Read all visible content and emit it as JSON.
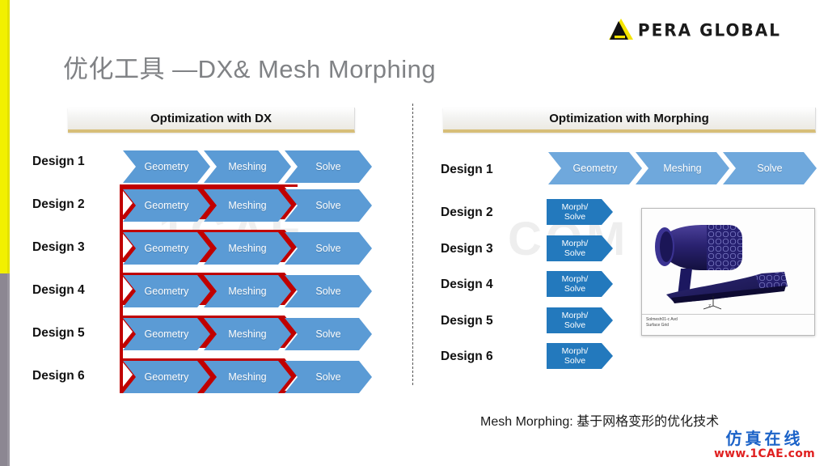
{
  "slide": {
    "title": "优化工具 —DX& Mesh Morphing",
    "caption": "Mesh Morphing: 基于网格变形的优化技术"
  },
  "logo": {
    "wordmark": "PERA GLOBAL",
    "mark_icon": "pera-triangle-icon",
    "yellow": "#F4E400",
    "black": "#111111"
  },
  "edge_bars": {
    "yellow": "#F2F000",
    "gray": "#8C8792"
  },
  "left_panel": {
    "header": "Optimization with DX",
    "stage_labels": [
      "Geometry",
      "Meshing",
      "Solve"
    ],
    "design_labels": [
      "Design 1",
      "Design 2",
      "Design 3",
      "Design 4",
      "Design 5",
      "Design 6"
    ],
    "rows": [
      {
        "label": "Design 1",
        "stages": [
          "Geometry",
          "Meshing",
          "Solve"
        ],
        "highlighted": false
      },
      {
        "label": "Design 2",
        "stages": [
          "Geometry",
          "Meshing",
          "Solve"
        ],
        "highlighted": true
      },
      {
        "label": "Design 3",
        "stages": [
          "Geometry",
          "Meshing",
          "Solve"
        ],
        "highlighted": true
      },
      {
        "label": "Design 4",
        "stages": [
          "Geometry",
          "Meshing",
          "Solve"
        ],
        "highlighted": true
      },
      {
        "label": "Design 5",
        "stages": [
          "Geometry",
          "Meshing",
          "Solve"
        ],
        "highlighted": true
      },
      {
        "label": "Design 6",
        "stages": [
          "Geometry",
          "Meshing",
          "Solve"
        ],
        "highlighted": true
      }
    ],
    "highlight_color": "#C00000",
    "chevron_color": "#5B9BD5"
  },
  "right_panel": {
    "header": "Optimization with Morphing",
    "rows": [
      {
        "label": "Design 1",
        "type": "full",
        "stages": [
          "Geometry",
          "Meshing",
          "Solve"
        ]
      },
      {
        "label": "Design 2",
        "type": "morph",
        "line1": "Morph/",
        "line2": "Solve"
      },
      {
        "label": "Design 3",
        "type": "morph",
        "line1": "Morph/",
        "line2": "Solve"
      },
      {
        "label": "Design 4",
        "type": "morph",
        "line1": "Morph/",
        "line2": "Solve"
      },
      {
        "label": "Design 5",
        "type": "morph",
        "line1": "Morph/",
        "line2": "Solve"
      },
      {
        "label": "Design 6",
        "type": "morph",
        "line1": "Morph/",
        "line2": "Solve"
      }
    ],
    "morph_color": "#2379BD",
    "chevron_color": "#5B9BD5"
  },
  "thumbnail": {
    "name": "cfd-surface-mesh-image",
    "legend_line1": "Solmesh01-c  Avd",
    "legend_line2": "Surface Grid",
    "axis_z": "Z",
    "axis_y": "Y",
    "axis_x": "X"
  },
  "watermarks": {
    "center_left": "1CAE",
    "center_right": "COM",
    "brand_cn": "仿真在线",
    "brand_url": "www.1CAE.com"
  }
}
